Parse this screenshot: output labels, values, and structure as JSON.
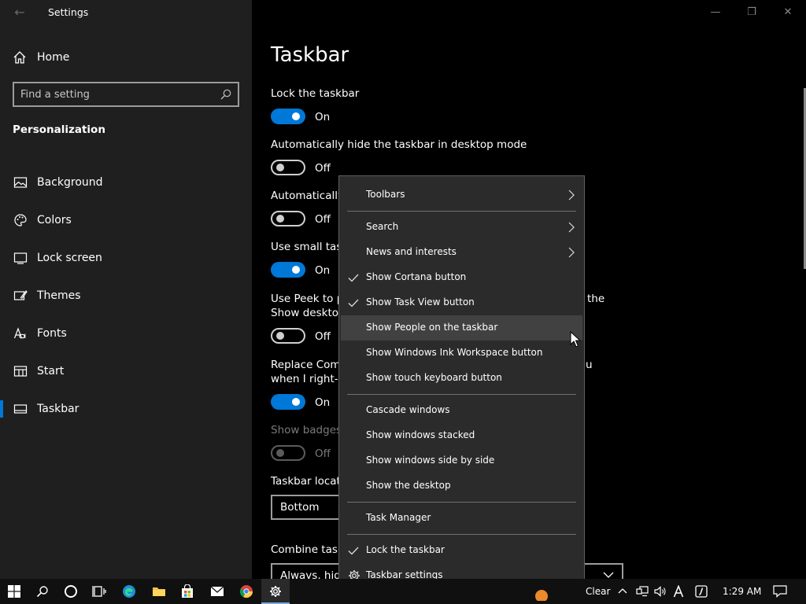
{
  "window": {
    "title": "Settings",
    "back_glyph": "←",
    "minimize_glyph": "—",
    "maximize_glyph": "❐",
    "close_glyph": "✕"
  },
  "sidebar": {
    "home_label": "Home",
    "search_placeholder": "Find a setting",
    "section_title": "Personalization",
    "items": [
      {
        "label": "Background",
        "icon": "image-icon"
      },
      {
        "label": "Colors",
        "icon": "palette-icon"
      },
      {
        "label": "Lock screen",
        "icon": "lock-screen-icon"
      },
      {
        "label": "Themes",
        "icon": "themes-icon"
      },
      {
        "label": "Fonts",
        "icon": "fonts-icon"
      },
      {
        "label": "Start",
        "icon": "start-icon"
      },
      {
        "label": "Taskbar",
        "icon": "taskbar-icon",
        "selected": true
      }
    ],
    "accent_color": "#0078d7"
  },
  "main": {
    "page_title": "Taskbar",
    "settings": [
      {
        "label": "Lock the taskbar",
        "state": "On"
      },
      {
        "label": "Automatically hide the taskbar in desktop mode",
        "state": "Off"
      },
      {
        "label": "Automatically",
        "state": "Off"
      },
      {
        "label": "Use small task",
        "state": "On"
      },
      {
        "label_line1": "Use Peek to p",
        "label_suffix": "the",
        "label_line2": "Show desktop",
        "state": "Off"
      },
      {
        "label_line1": "Replace Comm",
        "label_suffix": "u",
        "label_line2": "when I right-c",
        "state": "On"
      },
      {
        "label": "Show badges",
        "state": "Off",
        "disabled": true
      }
    ],
    "taskbar_location": {
      "label": "Taskbar locatio",
      "value": "Bottom"
    },
    "combine": {
      "label": "Combine task",
      "value": "Always, hide"
    }
  },
  "context_menu": {
    "items": [
      {
        "label": "Toolbars",
        "submenu": true
      },
      {
        "label": "Search",
        "submenu": true
      },
      {
        "label": "News and interests",
        "submenu": true
      },
      {
        "label": "Show Cortana button",
        "checked": true
      },
      {
        "label": "Show Task View button",
        "checked": true
      },
      {
        "label": "Show People on the taskbar",
        "highlighted": true
      },
      {
        "label": "Show Windows Ink Workspace button"
      },
      {
        "label": "Show touch keyboard button"
      },
      {
        "label": "Cascade windows"
      },
      {
        "label": "Show windows stacked"
      },
      {
        "label": "Show windows side by side"
      },
      {
        "label": "Show the desktop"
      },
      {
        "label": "Task Manager"
      },
      {
        "label": "Lock the taskbar",
        "checked": true
      },
      {
        "label": "Taskbar settings",
        "icon": "gear-icon"
      }
    ]
  },
  "taskbar": {
    "weather_text": "Clear",
    "clock": "1:29 AM",
    "pinned": [
      "windows-start-icon",
      "search-icon",
      "cortana-icon",
      "task-view-icon",
      "edge-icon",
      "file-explorer-icon",
      "store-icon",
      "mail-icon",
      "chrome-icon",
      "settings-icon"
    ]
  }
}
